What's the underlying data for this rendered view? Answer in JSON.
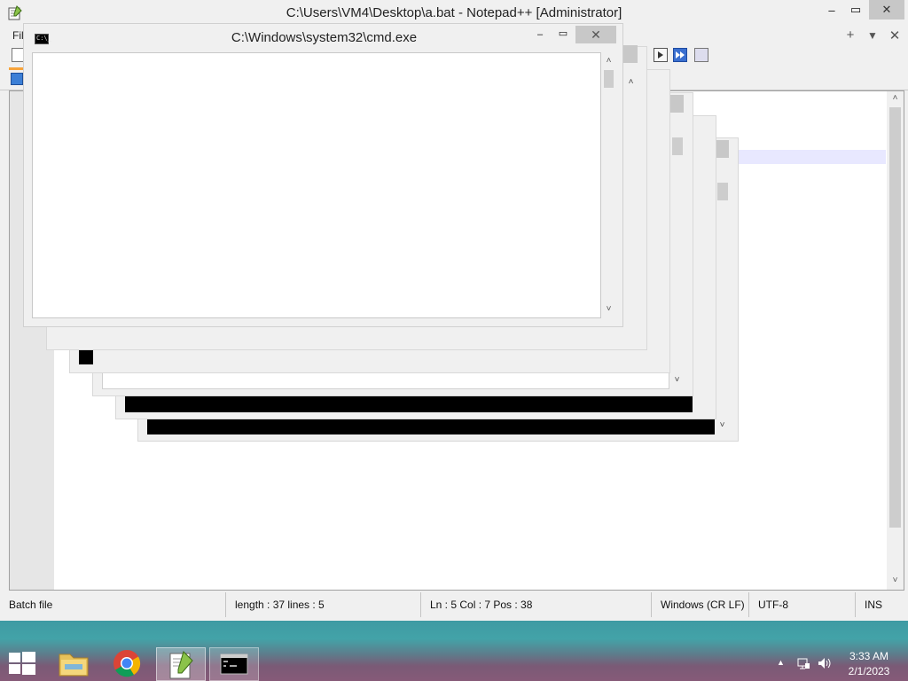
{
  "notepad": {
    "title": "C:\\Users\\VM4\\Desktop\\a.bat - Notepad++ [Administrator]",
    "min_glyph": "–",
    "max_glyph": "▭",
    "close_glyph": "✕",
    "menu_file": "Fil",
    "tab_plus": "+",
    "tab_down": "▼",
    "tab_close": "✕",
    "status": {
      "type": "Batch file",
      "length_lines": "length : 37    lines : 5",
      "position": "Ln : 5    Col : 7    Pos : 38",
      "eol": "Windows (CR LF)",
      "encoding": "UTF-8",
      "mode": "INS"
    },
    "scroll_up": "˄",
    "scroll_down": "˅"
  },
  "cmd": {
    "title": "C:\\Windows\\system32\\cmd.exe",
    "icon_text": "C:\\_",
    "min_glyph": "–",
    "max_glyph": "▭",
    "close_glyph": "✕",
    "scroll_up": "˄",
    "scroll_down": "˅"
  },
  "taskbar": {
    "time": "3:33 AM",
    "date": "2/1/2023",
    "tray_arrow": "▲",
    "network_icon": "network-icon",
    "volume_icon": "volume-icon"
  }
}
